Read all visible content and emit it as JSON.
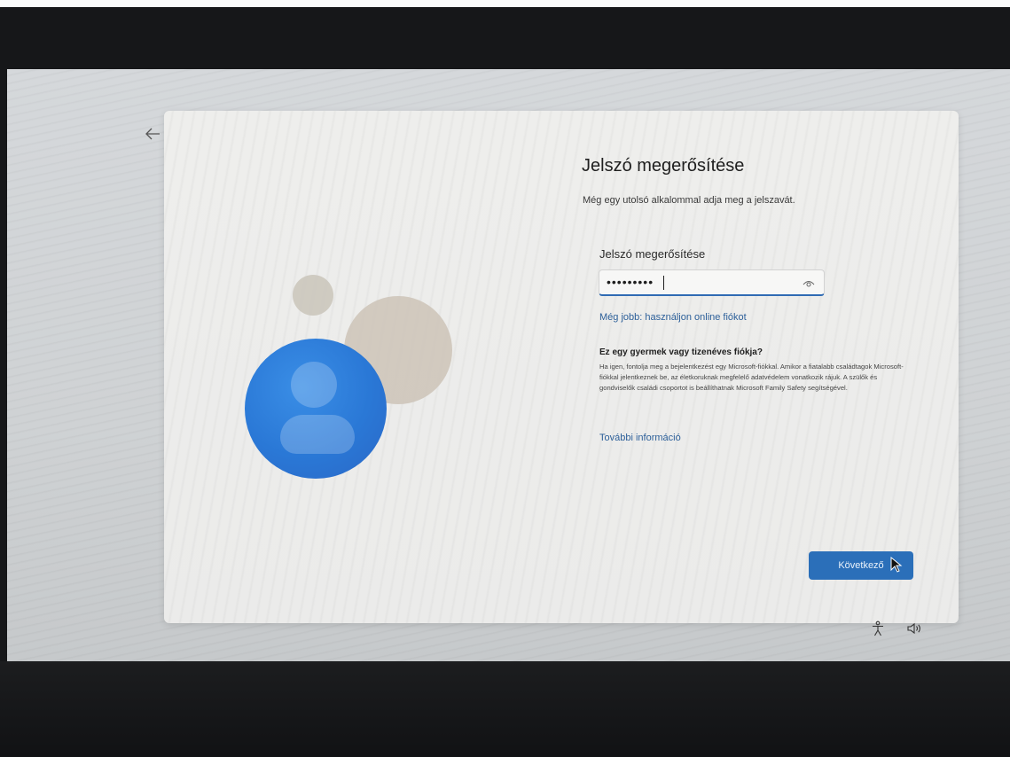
{
  "oobe": {
    "title": "Jelszó megerősítése",
    "subtitle": "Még egy utolsó alkalommal adja meg a jelszavát.",
    "password_field": {
      "label": "Jelszó megerősítése",
      "value": "•••••••••"
    },
    "online_account_link": "Még jobb: használjon online fiókot",
    "child_account": {
      "heading": "Ez egy gyermek vagy tizenéves fiókja?",
      "text": "Ha igen, fontolja meg a bejelentkezést egy Microsoft-fiókkal. Amikor a fiatalabb családtagok Microsoft-fiókkal jelentkeznek be, az életkoruknak megfelelő adatvédelem vonatkozik rájuk. A szülők és gondviselők családi csoportot is beállíthatnak Microsoft Family Safety segítségével."
    },
    "more_info_link": "További információ",
    "next_button": "Következő"
  },
  "colors": {
    "accent": "#2b6fb9",
    "link": "#2c5f99",
    "illustration_blue": "#2a78d6"
  },
  "icons": {
    "back": "arrow-left-icon",
    "password_reveal": "eye-icon",
    "accessibility": "accessibility-icon",
    "volume": "volume-icon",
    "cursor": "mouse-pointer-icon"
  }
}
